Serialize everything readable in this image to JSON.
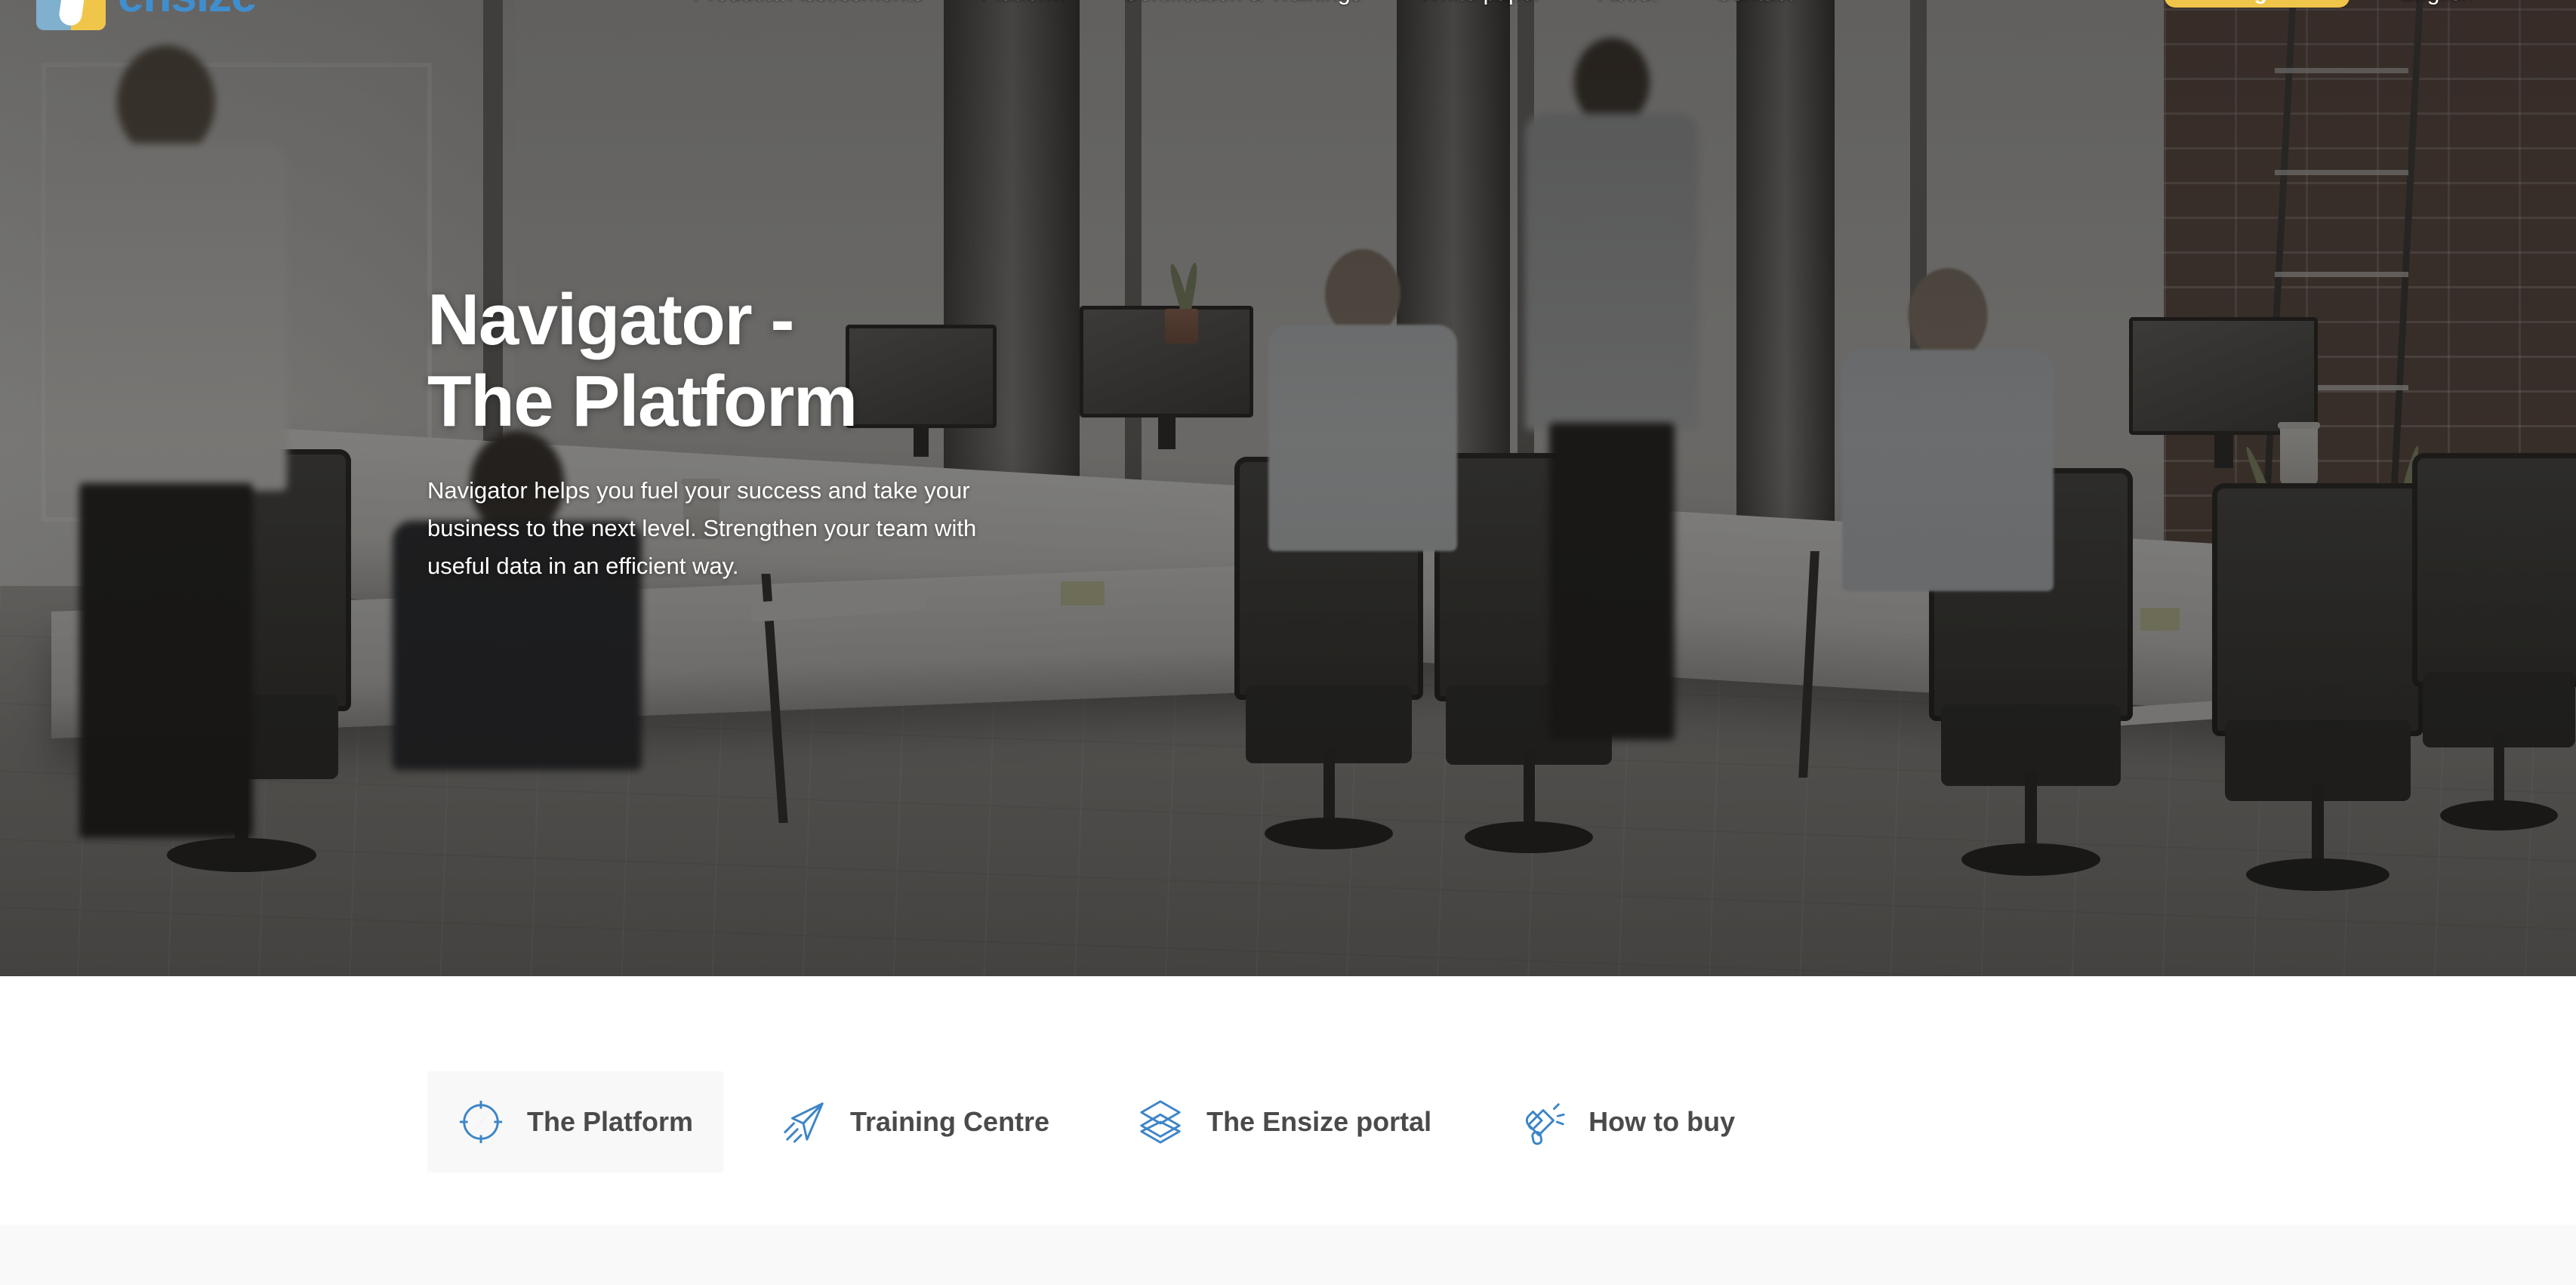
{
  "header": {
    "logo": {
      "text": "ensize",
      "mark_blue": "#7fb0cd",
      "mark_yellow": "#f0c64a",
      "text_color": "#3f8fd0"
    },
    "nav_items": [
      {
        "label": "Products/Assessments"
      },
      {
        "label": "Platform"
      },
      {
        "label": "Certification & Trainings"
      },
      {
        "label": "White paper"
      },
      {
        "label": "About"
      },
      {
        "label": "Contact"
      }
    ],
    "login_label": "Login",
    "login_color": "#f0c64a",
    "language": "English"
  },
  "hero": {
    "title_line1": "Navigator -",
    "title_line2": "The Platform",
    "subtitle": "Navigator helps you fuel your success and take your business to the next level. Strengthen your team with useful data in an efficient way.",
    "overlay_color": "#121110"
  },
  "tabs": {
    "accent_color": "#3d85c8",
    "active_bg": "#f8f8f8",
    "items": [
      {
        "label": "The Platform",
        "icon": "compass-icon",
        "active": true
      },
      {
        "label": "Training Centre",
        "icon": "paper-plane-icon",
        "active": false
      },
      {
        "label": "The Ensize portal",
        "icon": "layers-icon",
        "active": false
      },
      {
        "label": "How to buy",
        "icon": "megaphone-icon",
        "active": false
      }
    ]
  }
}
